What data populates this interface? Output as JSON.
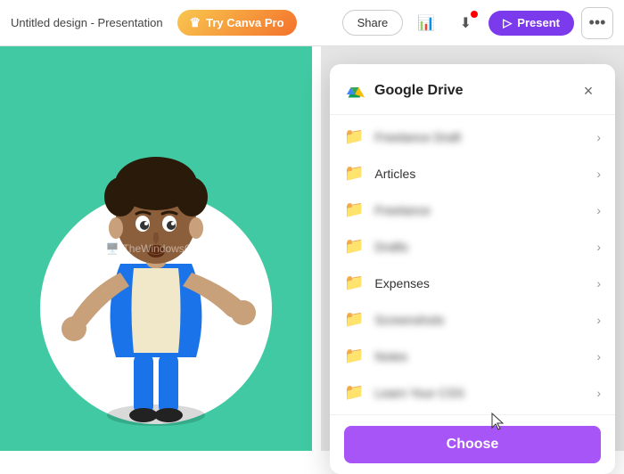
{
  "toolbar": {
    "title": "Untitled design - Presentation",
    "try_canva_label": "Try Canva Pro",
    "share_label": "Share",
    "present_label": "Present",
    "more_label": "..."
  },
  "watermark": {
    "text": "TheWindowsClub"
  },
  "modal": {
    "title": "Google Drive",
    "close_label": "×",
    "choose_label": "Choose",
    "folders": [
      {
        "id": 1,
        "name": "Freelance Draft",
        "blurred": true
      },
      {
        "id": 2,
        "name": "Articles",
        "blurred": false
      },
      {
        "id": 3,
        "name": "Freelance",
        "blurred": true
      },
      {
        "id": 4,
        "name": "Drafts",
        "blurred": true
      },
      {
        "id": 5,
        "name": "Expenses",
        "blurred": false
      },
      {
        "id": 6,
        "name": "Screenshots",
        "blurred": true
      },
      {
        "id": 7,
        "name": "Notes",
        "blurred": true
      },
      {
        "id": 8,
        "name": "Learn Your CSS",
        "blurred": true
      }
    ]
  },
  "colors": {
    "accent": "#a855f7",
    "canvas_bg": "#40c9a2"
  }
}
